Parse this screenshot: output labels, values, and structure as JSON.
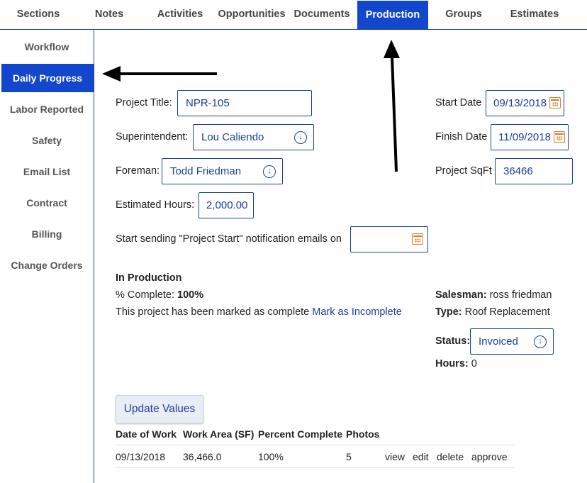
{
  "topnav": {
    "tabs": [
      {
        "label": "Sections"
      },
      {
        "label": "Notes"
      },
      {
        "label": "Activities"
      },
      {
        "label": "Opportunities"
      },
      {
        "label": "Documents"
      },
      {
        "label": "Production"
      },
      {
        "label": "Groups"
      },
      {
        "label": "Estimates"
      }
    ],
    "active_tab": "Production"
  },
  "sidebar": {
    "items": [
      {
        "label": "Workflow"
      },
      {
        "label": "Daily Progress"
      },
      {
        "label": "Labor Reported"
      },
      {
        "label": "Safety"
      },
      {
        "label": "Email List"
      },
      {
        "label": "Contract"
      },
      {
        "label": "Billing"
      },
      {
        "label": "Change Orders"
      }
    ],
    "active_item": "Daily Progress"
  },
  "form": {
    "project_title": {
      "label": "Project Title:",
      "value": "NPR-105"
    },
    "superintendent": {
      "label": "Superintendent:",
      "value": "Lou Caliendo"
    },
    "foreman": {
      "label": "Foreman:",
      "value": "Todd Friedman"
    },
    "estimated_hours": {
      "label": "Estimated Hours:",
      "value": "2,000.00"
    },
    "notification": {
      "label": "Start sending \"Project Start\" notification emails on",
      "value": ""
    },
    "start_date": {
      "label": "Start Date",
      "value": "09/13/2018"
    },
    "finish_date": {
      "label": "Finish Date",
      "value": "11/09/2018"
    },
    "project_sqft": {
      "label": "Project SqFt",
      "value": "36466"
    }
  },
  "status_block": {
    "heading": "In Production",
    "complete_label": "% Complete:",
    "complete_value": "100%",
    "marked_text": "This project has been marked as complete",
    "mark_link": "Mark as Incomplete",
    "salesman_label": "Salesman:",
    "salesman_value": "ross friedman",
    "type_label": "Type:",
    "type_value": "Roof Replacement",
    "status_label": "Status:",
    "status_value": "Invoiced",
    "hours_label": "Hours:",
    "hours_value": "0"
  },
  "update_button": "Update Values",
  "table": {
    "headers": [
      "Date of Work",
      "Work Area (SF)",
      "Percent Complete",
      "Photos"
    ],
    "rows": [
      {
        "date": "09/13/2018",
        "area": "36,466.0",
        "percent": "100%",
        "photos": "5",
        "actions": [
          "view",
          "edit",
          "delete",
          "approve"
        ]
      }
    ]
  },
  "colors": {
    "accent": "#1246cc",
    "link": "#1c3f9e",
    "calendar_icon": "#e07b22"
  },
  "icons": [
    "select-arrow-icon",
    "calendar-icon",
    "annotation-arrow"
  ]
}
